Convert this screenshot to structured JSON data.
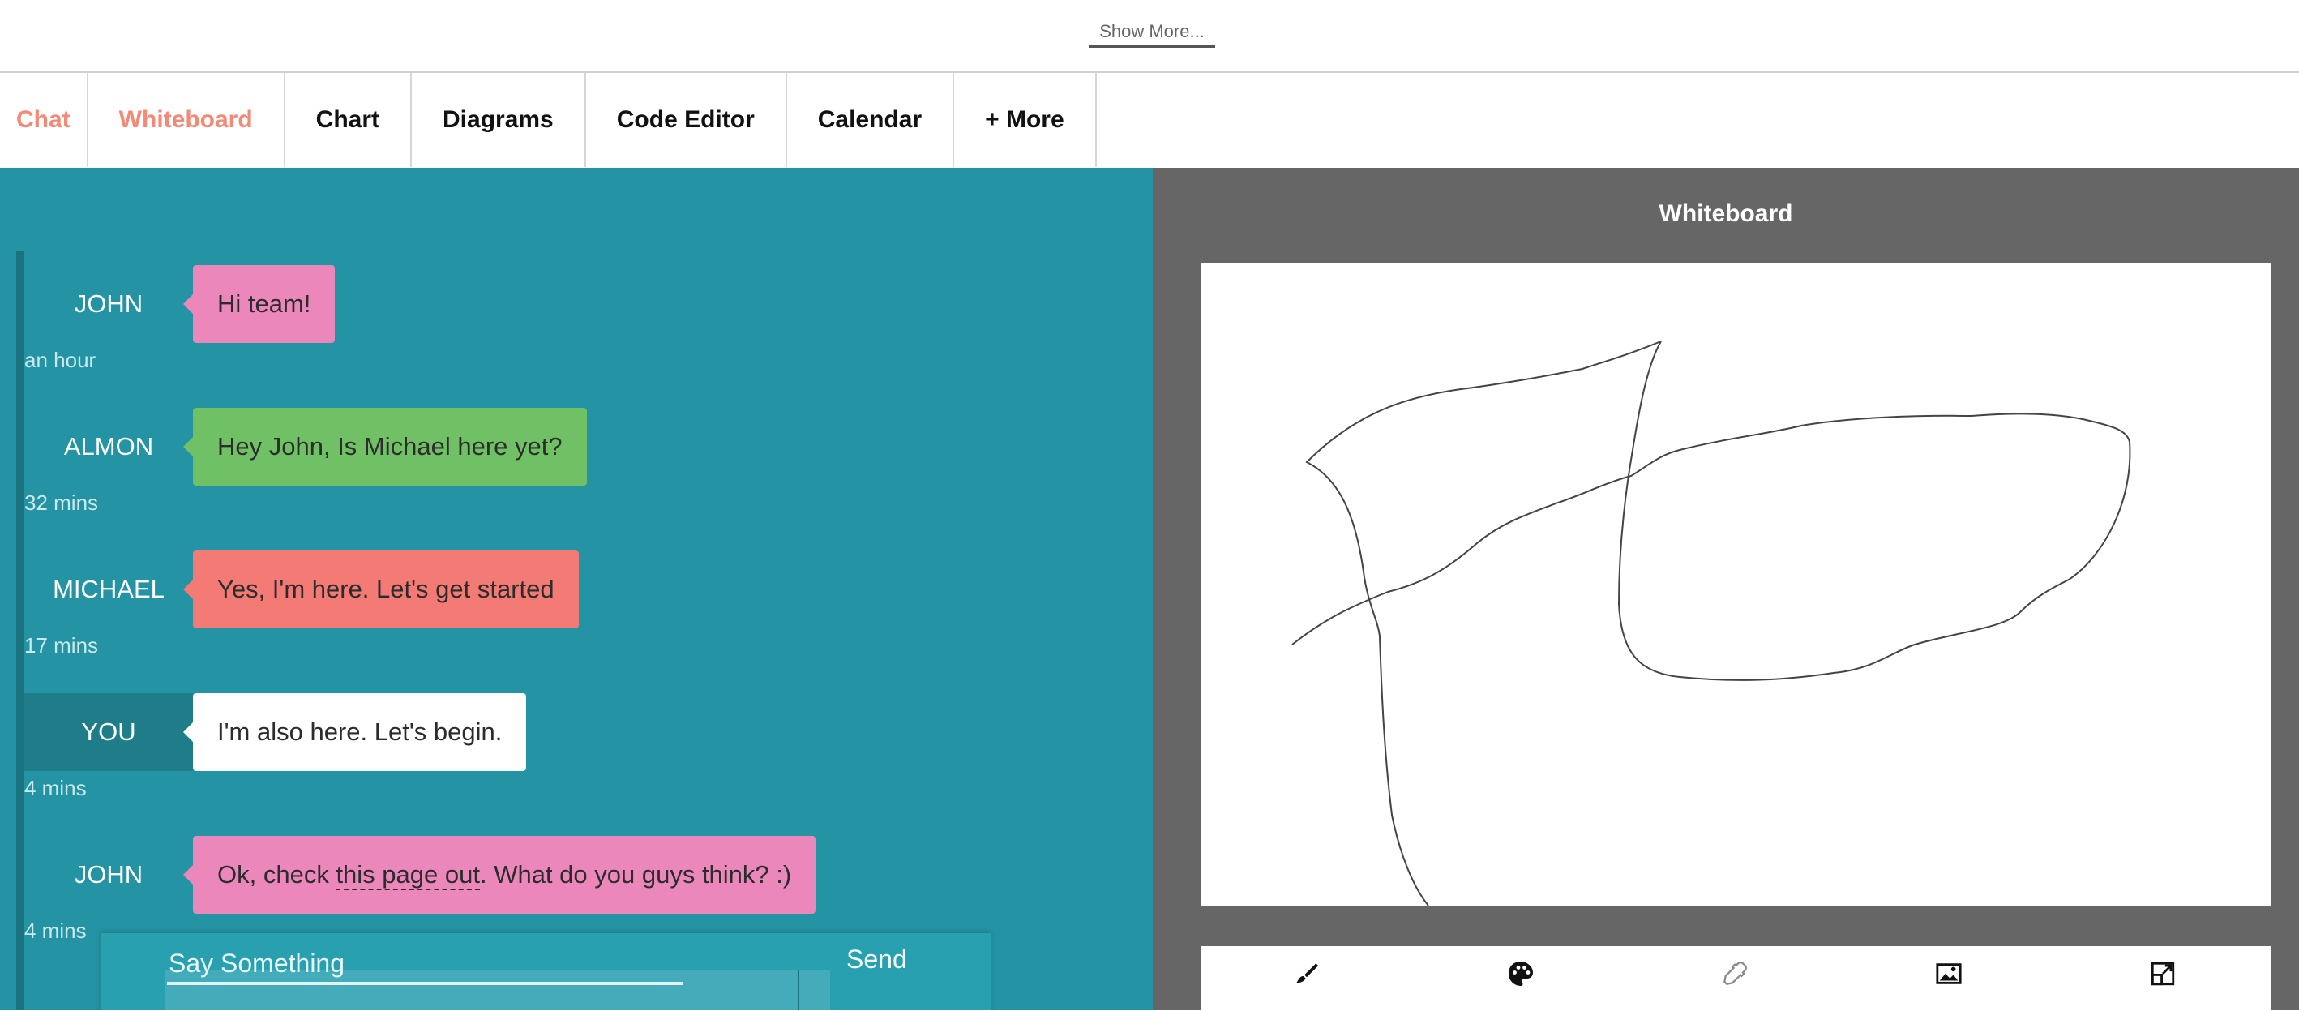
{
  "top": {
    "show_more": "Show More..."
  },
  "tabs": [
    {
      "label": "Chat",
      "active": true
    },
    {
      "label": "Whiteboard",
      "active": true
    },
    {
      "label": "Chart"
    },
    {
      "label": "Diagrams"
    },
    {
      "label": "Code Editor"
    },
    {
      "label": "Calendar"
    },
    {
      "label": "+ More"
    }
  ],
  "chat": {
    "messages": [
      {
        "name": "JOHN",
        "text": "Hi team!",
        "time": "an hour",
        "color": "#ec87bb"
      },
      {
        "name": "ALMON",
        "text": "Hey John, Is Michael here yet?",
        "time": "32 mins",
        "color": "#70c066"
      },
      {
        "name": "MICHAEL",
        "text": "Yes, I'm here. Let's get started",
        "time": "17 mins",
        "color": "#f47a75"
      },
      {
        "name": "YOU",
        "text": "I'm also here. Let's begin.",
        "time": "4 mins",
        "color": "#ffffff"
      },
      {
        "name": "JOHN",
        "text_before": "Ok, check ",
        "link": "this page out",
        "text_after": ". What do you guys think? :)",
        "time": "4 mins",
        "color": "#ec87bb"
      }
    ],
    "composer": {
      "placeholder": "Say Something",
      "send": "Send"
    }
  },
  "whiteboard": {
    "title": "Whiteboard",
    "tools": [
      "brush-icon",
      "palette-icon",
      "eyedropper-icon",
      "image-icon",
      "expand-icon"
    ]
  },
  "colors": {
    "accent": "#f28a78",
    "chat_bg": "#2493a3",
    "whiteboard_bg": "#666666"
  }
}
